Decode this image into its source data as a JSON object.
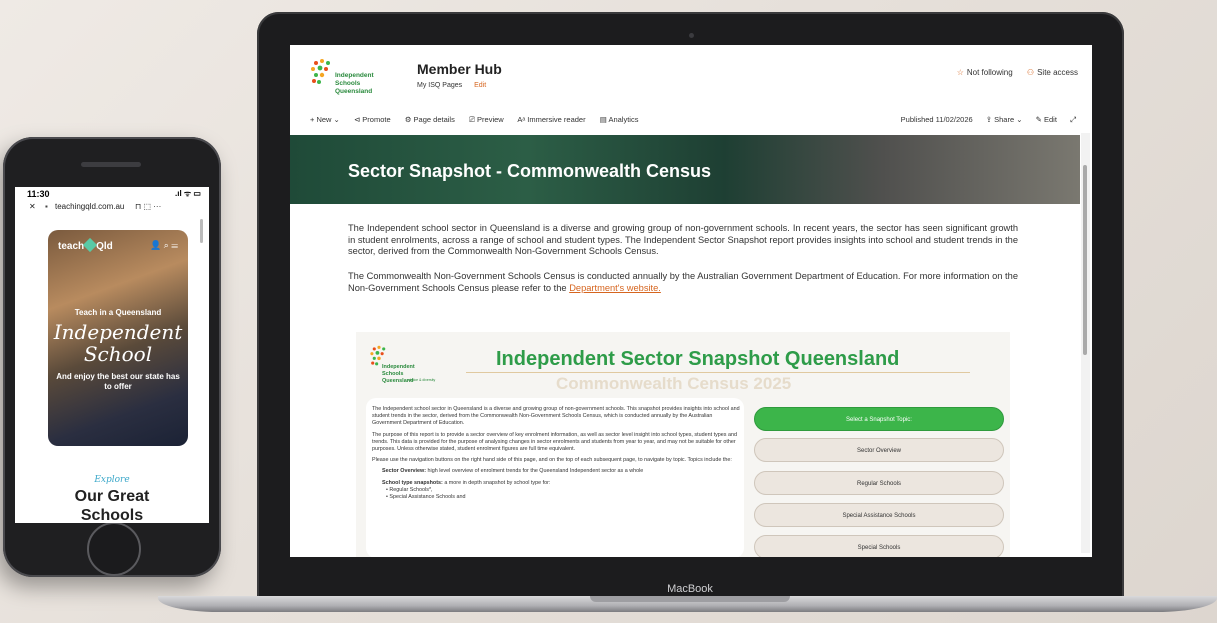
{
  "phone": {
    "time": "11:30",
    "status_icons": ".ıl ᯤ ▭",
    "url": "teachingqld.com.au",
    "close": "✕",
    "url_icons": "⊓ ⬚ ···",
    "brand_left": "teach",
    "brand_right": "Qld",
    "nav_icons": "👤 ⌕ ☰",
    "hero_line1": "Teach in a Queensland",
    "hero_line2": "Independent",
    "hero_line3": "School",
    "hero_line4": "And enjoy the best our state has to offer",
    "explore": "Explore",
    "great": "Our Great Schools"
  },
  "laptop": {
    "brand": "MacBook",
    "site": {
      "logo_text": "Independent Schools Queensland",
      "title": "Member Hub",
      "sub": "My ISQ Pages",
      "edit": "Edit",
      "not_following": "Not following",
      "site_access": "Site access"
    },
    "commands": {
      "new": "+ New ⌄",
      "promote": "⊲ Promote",
      "page_details": "⚙ Page details",
      "preview": "⎚ Preview",
      "immersive": "Aᵃ Immersive reader",
      "analytics": "▤ Analytics",
      "published": "Published 11/02/2026",
      "share": "⇪ Share ⌄",
      "edit": "✎ Edit",
      "expand": "⤢"
    },
    "banner_title": "Sector Snapshot - Commonwealth Census",
    "para1": "The Independent school sector in Queensland is a diverse and growing group of non-government schools. In recent years, the sector has seen significant growth in student enrolments, across a range of school and student types. The Independent Sector Snapshot report provides insights into school and student trends in the sector, derived from the Commonwealth Non-Government Schools Census.",
    "para2": "The Commonwealth Non-Government Schools Census is conducted annually by the Australian Government Department of Education. For more information on the Non-Government Schools Census please refer to the",
    "para2_link": "Department's website.",
    "report": {
      "logo_text": "Independent Schools Queensland",
      "logo_tag": "choice & diversity",
      "title": "Independent Sector Snapshot Queensland",
      "subtitle": "Commonwealth Census 2025",
      "p1": "The Independent school sector in Queensland is a diverse and growing group of non-government schools. This snapshot provides insights into school and student trends in the sector, derived from the Commonwealth Non-Government Schools Census, which is conducted annually by the Australian Government Department of Education.",
      "p2": "The purpose of this report is to provide a sector overview of key enrolment information, as well as sector level insight into school types, student types and trends. This data is provided for the purpose of analysing changes in sector enrolments and students from year to year, and may not be suitable for other purposes. Unless otherwise stated, student enrolment figures are full time equivalent.",
      "p3": "Please use the navigation buttons on the right hand side of this page, and on the top of each subsequent page, to navigate by topic. Topics include the:",
      "p4_bold": "Sector Overview:",
      "p4": "high level overview of enrolment trends for the Queensland Independent sector as a whole",
      "p5_bold": "School type snapshots:",
      "p5": "a more in depth snapshot by school type for:",
      "bullet1": "• Regular Schools*,",
      "bullet2": "• Special Assistance Schools and",
      "buttons": [
        "Select a Snapshot Topic:",
        "Sector Overview",
        "Regular Schools",
        "Special Assistance Schools",
        "Special Schools"
      ]
    }
  },
  "colors": {
    "accent_green": "#3cb54a",
    "accent_orange": "#d6651f",
    "banner_green": "#1f4a38"
  }
}
